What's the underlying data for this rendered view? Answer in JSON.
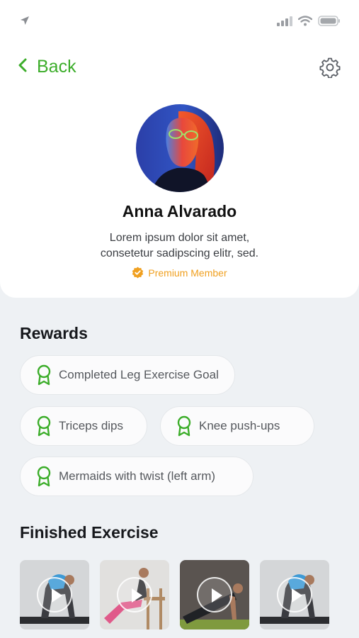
{
  "nav": {
    "back_label": "Back"
  },
  "profile": {
    "name": "Anna Alvarado",
    "bio_line1": "Lorem ipsum dolor sit amet,",
    "bio_line2": "consetetur sadipscing elitr, sed.",
    "membership": "Premium Member"
  },
  "rewards": {
    "title": "Rewards",
    "items": [
      {
        "label": "Completed Leg Exercise Goal"
      },
      {
        "label": "Triceps dips"
      },
      {
        "label": "Knee push-ups"
      },
      {
        "label": "Mermaids with twist (left arm)"
      }
    ]
  },
  "finished": {
    "title": "Finished Exercise"
  },
  "colors": {
    "accent_green": "#3cad2a",
    "premium_orange": "#f0a020",
    "background": "#eef1f4",
    "card": "#ffffff"
  },
  "icons": {
    "back": "chevron-left-icon",
    "settings": "gear-icon",
    "reward": "award-ribbon-icon",
    "verified": "verified-check-icon",
    "play": "play-icon"
  }
}
